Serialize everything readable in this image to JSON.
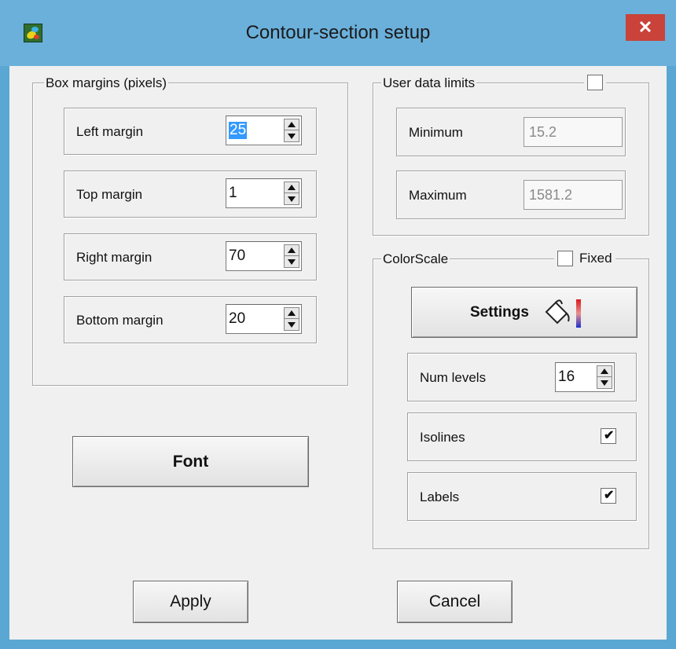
{
  "window": {
    "title": "Contour-section setup",
    "close_symbol": "✕",
    "icon": "contour-app-icon"
  },
  "box_margins": {
    "legend": "Box margins (pixels)",
    "rows": [
      {
        "label": "Left margin",
        "value": "25"
      },
      {
        "label": "Top margin",
        "value": "1"
      },
      {
        "label": "Right margin",
        "value": "70"
      },
      {
        "label": "Bottom margin",
        "value": "20"
      }
    ]
  },
  "user_data_limits": {
    "legend": "User data limits",
    "enabled": false,
    "minimum_label": "Minimum",
    "minimum_value": "15.2",
    "maximum_label": "Maximum",
    "maximum_value": "1581.2"
  },
  "colorscale": {
    "legend": "ColorScale",
    "fixed_label": "Fixed",
    "fixed": false,
    "settings_label": "Settings",
    "settings_icon": "paint-bucket-icon",
    "num_levels_label": "Num levels",
    "num_levels_value": "16",
    "isolines_label": "Isolines",
    "isolines_checked": true,
    "labels_label": "Labels",
    "labels_checked": true
  },
  "buttons": {
    "font": "Font",
    "apply": "Apply",
    "cancel": "Cancel"
  },
  "colors": {
    "titlebar": "#6bb0db",
    "close": "#c9433b",
    "selection": "#3399ff"
  }
}
